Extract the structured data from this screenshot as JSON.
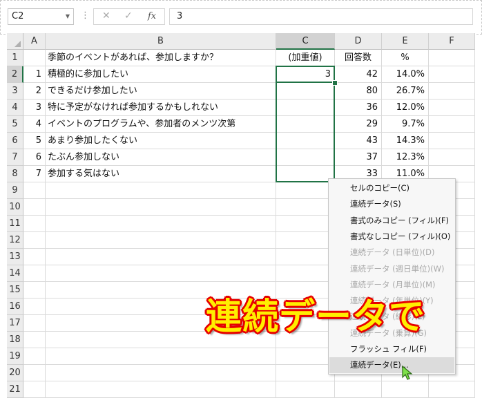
{
  "formula_bar": {
    "name_box": "C2",
    "cancel_symbol": "✕",
    "enter_symbol": "✓",
    "fx_label": "fx",
    "formula_value": "3"
  },
  "columns": [
    "A",
    "B",
    "C",
    "D",
    "E",
    "F"
  ],
  "rows": [
    {
      "n": "1",
      "a": "",
      "b": "季節のイベントがあれば、参加しますか？",
      "c": "(加重値)",
      "d": "回答数",
      "e": "%"
    },
    {
      "n": "2",
      "a": "1",
      "b": "積極的に参加したい",
      "c": "3",
      "d": "42",
      "e": "14.0%"
    },
    {
      "n": "3",
      "a": "2",
      "b": "できるだけ参加したい",
      "c": "",
      "d": "80",
      "e": "26.7%"
    },
    {
      "n": "4",
      "a": "3",
      "b": "特に予定がなければ参加するかもしれない",
      "c": "",
      "d": "36",
      "e": "12.0%"
    },
    {
      "n": "5",
      "a": "4",
      "b": "イベントのプログラムや、参加者のメンツ次第",
      "c": "",
      "d": "29",
      "e": "9.7%"
    },
    {
      "n": "6",
      "a": "5",
      "b": "あまり参加したくない",
      "c": "",
      "d": "43",
      "e": "14.3%"
    },
    {
      "n": "7",
      "a": "6",
      "b": "たぶん参加しない",
      "c": "",
      "d": "37",
      "e": "12.3%"
    },
    {
      "n": "8",
      "a": "7",
      "b": "参加する気はない",
      "c": "",
      "d": "33",
      "e": "11.0%"
    },
    {
      "n": "9"
    },
    {
      "n": "10"
    },
    {
      "n": "11"
    },
    {
      "n": "12"
    },
    {
      "n": "13"
    },
    {
      "n": "14"
    },
    {
      "n": "15"
    },
    {
      "n": "16"
    },
    {
      "n": "17"
    },
    {
      "n": "18"
    },
    {
      "n": "19"
    },
    {
      "n": "20"
    },
    {
      "n": "21"
    }
  ],
  "context_menu": {
    "items": [
      {
        "label": "セルのコピー(C)",
        "disabled": false
      },
      {
        "label": "連続データ(S)",
        "disabled": false
      },
      {
        "label": "書式のみコピー (フィル)(F)",
        "disabled": false
      },
      {
        "label": "書式なしコピー (フィル)(O)",
        "disabled": false
      },
      {
        "label": "連続データ (日単位)(D)",
        "disabled": true
      },
      {
        "label": "連続データ (週日単位)(W)",
        "disabled": true
      },
      {
        "label": "連続データ (月単位)(M)",
        "disabled": true
      },
      {
        "label": "連続データ (年単位)(Y)",
        "disabled": true
      },
      {
        "label": "連続データ (線形)(L)",
        "disabled": true
      },
      {
        "label": "連続データ (乗算)(G)",
        "disabled": true
      },
      {
        "label": "フラッシュ フィル(F)",
        "disabled": false
      },
      {
        "label": "連続データ(E)...",
        "disabled": false,
        "highlighted": true
      }
    ]
  },
  "caption": "連続データで",
  "colors": {
    "selection": "#217346",
    "caption_fill": "#ffee00",
    "caption_outline": "#e60000"
  }
}
